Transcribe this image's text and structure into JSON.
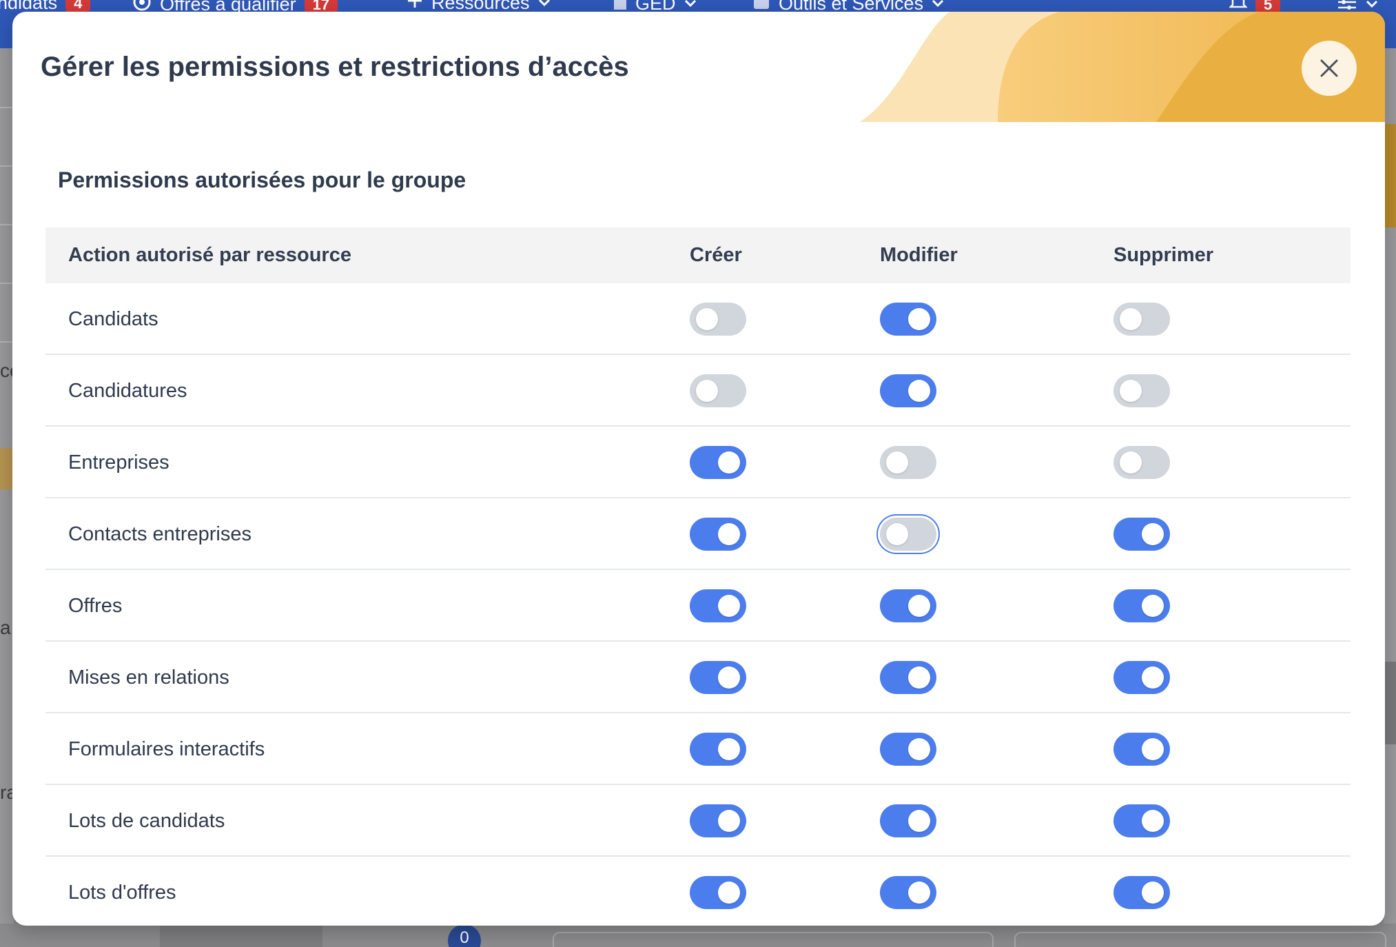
{
  "background_nav": {
    "items": [
      {
        "label": "ndidats",
        "badge": "4"
      },
      {
        "label": "Offres à qualifier",
        "badge": "17"
      },
      {
        "label": "Ressources"
      },
      {
        "label": "GED"
      },
      {
        "label": "Outils et Services"
      },
      {
        "badge": "5"
      }
    ],
    "bottom_badge": "0",
    "left_fragments": [
      "cé",
      "a",
      "ra"
    ]
  },
  "modal": {
    "title": "Gérer les permissions et restrictions d’accès",
    "close_icon": "close-icon",
    "section_title": "Permissions autorisées pour le groupe",
    "columns": {
      "resource": "Action autorisé par ressource",
      "create": "Créer",
      "modify": "Modifier",
      "delete": "Supprimer"
    },
    "rows": [
      {
        "label": "Candidats",
        "create": false,
        "modify": true,
        "delete": false
      },
      {
        "label": "Candidatures",
        "create": false,
        "modify": true,
        "delete": false
      },
      {
        "label": "Entreprises",
        "create": true,
        "modify": false,
        "delete": false
      },
      {
        "label": "Contacts entreprises",
        "create": true,
        "modify": false,
        "delete": true
      },
      {
        "label": "Offres",
        "create": true,
        "modify": true,
        "delete": true
      },
      {
        "label": "Mises en relations",
        "create": true,
        "modify": true,
        "delete": true
      },
      {
        "label": "Formulaires interactifs",
        "create": true,
        "modify": true,
        "delete": true
      },
      {
        "label": "Lots de candidats",
        "create": true,
        "modify": true,
        "delete": true
      },
      {
        "label": "Lots d'offres",
        "create": true,
        "modify": true,
        "delete": true
      }
    ],
    "focused_toggle": {
      "row": 3,
      "column": "modify"
    }
  },
  "colors": {
    "toggle_on": "#4c7ded",
    "toggle_off": "#d1d5dc",
    "nav_blue": "#2f58b8",
    "badge_red": "#d63a3a",
    "accent_orange": "#eeb347"
  }
}
